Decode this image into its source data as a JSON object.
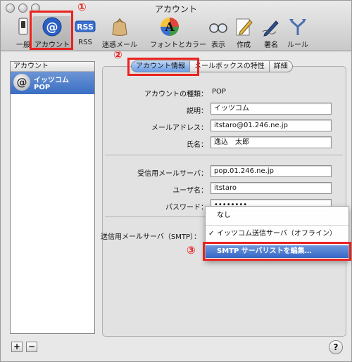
{
  "window": {
    "title": "アカウント"
  },
  "toolbar": {
    "items": [
      {
        "label": "一般",
        "icon": "switch-icon"
      },
      {
        "label": "アカウント",
        "icon": "at-sign-icon"
      },
      {
        "label": "RSS",
        "icon": "rss-icon"
      },
      {
        "label": "迷惑メール",
        "icon": "junk-mail-bag-icon"
      },
      {
        "label": "フォントとカラー",
        "icon": "font-color-icon"
      },
      {
        "label": "表示",
        "icon": "view-glasses-icon"
      },
      {
        "label": "作成",
        "icon": "compose-pencil-icon"
      },
      {
        "label": "署名",
        "icon": "signature-pen-icon"
      },
      {
        "label": "ルール",
        "icon": "rules-icon"
      }
    ],
    "rss_badge": "RSS"
  },
  "sidebar": {
    "header": "アカウント",
    "accounts": [
      {
        "name": "イッツコム",
        "type": "POP",
        "icon_glyph": "@"
      }
    ]
  },
  "tabs": [
    {
      "label": "アカウント情報",
      "selected": true
    },
    {
      "label": "メールボックスの特性",
      "selected": false
    },
    {
      "label": "詳細",
      "selected": false
    }
  ],
  "form": {
    "account_type_label": "アカウントの種類：",
    "account_type_value": "POP",
    "description_label": "説明：",
    "description_value": "イッツコム",
    "email_label": "メールアドレス：",
    "email_value": "itstaro@01.246.ne.jp",
    "fullname_label": "氏名：",
    "fullname_value": "逸込　太郎",
    "incoming_label": "受信用メールサーバ：",
    "incoming_value": "pop.01.246.ne.jp",
    "username_label": "ユーザ名：",
    "username_value": "itstaro",
    "password_label": "パスワード：",
    "password_value": "••••••••",
    "smtp_label": "送信用メールサーバ（SMTP）："
  },
  "smtp_menu": {
    "items": [
      {
        "label": "なし",
        "checked": false
      },
      {
        "label": "イッツコム送信サーバ（オフライン）",
        "checked": true,
        "check_glyph": "✓"
      },
      {
        "label": "SMTP サーバリストを編集…",
        "highlighted": true
      }
    ]
  },
  "annotations": {
    "step1": "①",
    "step2": "②",
    "step3": "③",
    "color": "#e8231f"
  },
  "bottom": {
    "add": "+",
    "remove": "−",
    "help": "?"
  }
}
